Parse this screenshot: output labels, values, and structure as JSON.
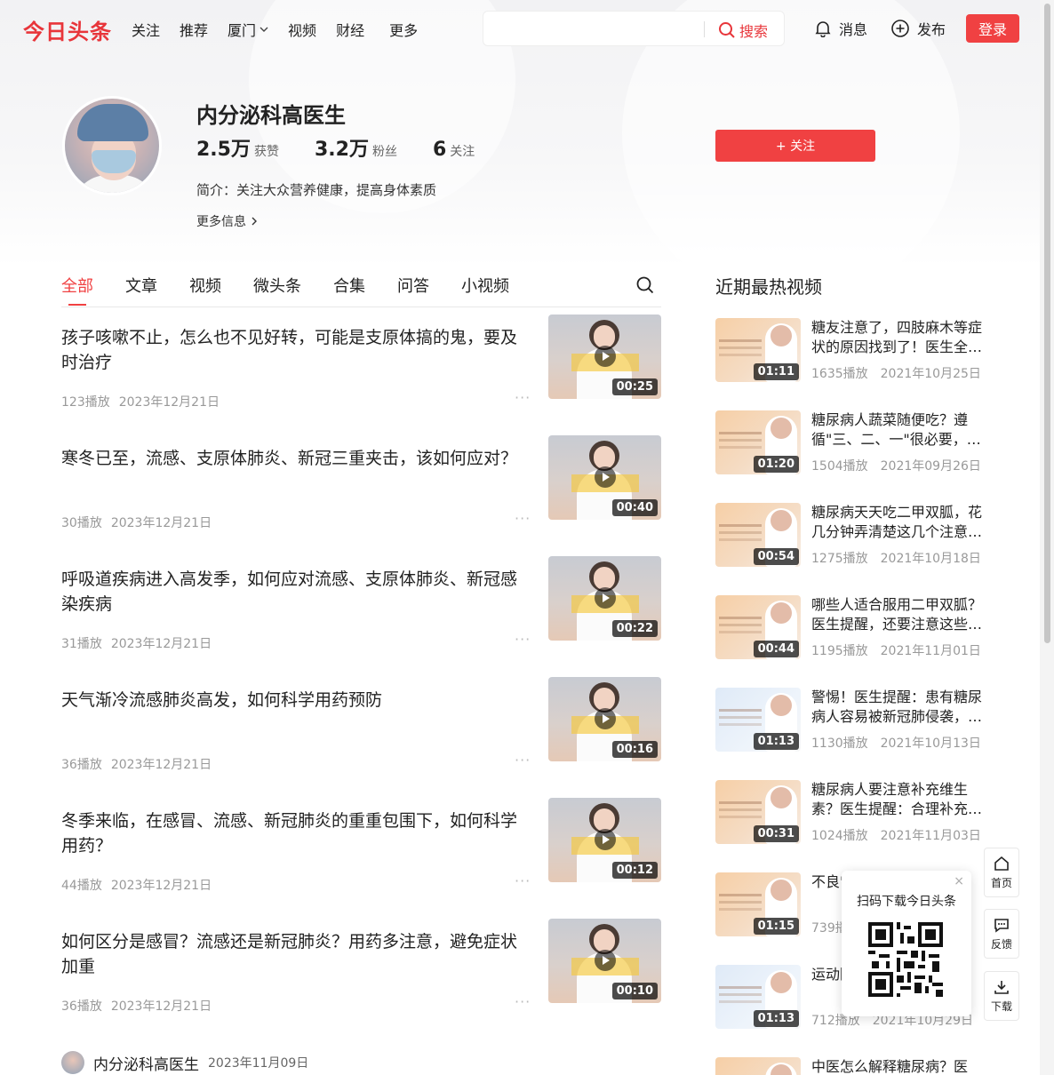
{
  "header": {
    "logo": "今日头条",
    "nav": [
      "关注",
      "推荐",
      "厦门",
      "视频",
      "财经",
      "更多"
    ],
    "search_button": "搜索",
    "search_placeholder": "",
    "messages": "消息",
    "publish": "发布",
    "login": "登录"
  },
  "profile": {
    "name": "内分泌科高医生",
    "likes_num": "2.5万",
    "likes_label": "获赞",
    "fans_num": "3.2万",
    "fans_label": "粉丝",
    "following_num": "6",
    "following_label": "关注",
    "follow_button": "+ 关注",
    "intro": "简介：关注大众营养健康，提高身体素质",
    "more_info": "更多信息"
  },
  "tabs": [
    "全部",
    "文章",
    "视频",
    "微头条",
    "合集",
    "问答",
    "小视频"
  ],
  "feed": [
    {
      "title": "孩子咳嗽不止，怎么也不见好转，可能是支原体搞的鬼，要及时治疗",
      "plays": "123播放",
      "date": "2023年12月21日",
      "duration": "00:25"
    },
    {
      "title": "寒冬已至，流感、支原体肺炎、新冠三重夹击，该如何应对？",
      "plays": "30播放",
      "date": "2023年12月21日",
      "duration": "00:40"
    },
    {
      "title": "呼吸道疾病进入高发季，如何应对流感、支原体肺炎、新冠感染疾病",
      "plays": "31播放",
      "date": "2023年12月21日",
      "duration": "00:22"
    },
    {
      "title": "天气渐冷流感肺炎高发，如何科学用药预防",
      "plays": "36播放",
      "date": "2023年12月21日",
      "duration": "00:16"
    },
    {
      "title": "冬季来临，在感冒、流感、新冠肺炎的重重包围下，如何科学用药？",
      "plays": "44播放",
      "date": "2023年12月21日",
      "duration": "00:12"
    },
    {
      "title": "如何区分是感冒？流感还是新冠肺炎？用药多注意，避免症状加重",
      "plays": "36播放",
      "date": "2023年12月21日",
      "duration": "00:10"
    }
  ],
  "author_row": {
    "name": "内分泌科高医生",
    "date": "2023年11月09日"
  },
  "sidebar": {
    "title": "近期最热视频",
    "videos": [
      {
        "title": "糖友注意了，四肢麻木等症状的原因找到了！医生全…",
        "plays": "1635播放",
        "date": "2021年10月25日",
        "duration": "01:11",
        "style": "orange"
      },
      {
        "title": "糖尿病人蔬菜随便吃？遵循\"三、二、一\"很必要，…",
        "plays": "1504播放",
        "date": "2021年09月26日",
        "duration": "01:20",
        "style": "orange"
      },
      {
        "title": "糖尿病天天吃二甲双胍，花几分钟弄清楚这几个注意…",
        "plays": "1275播放",
        "date": "2021年10月18日",
        "duration": "00:54",
        "style": "orange"
      },
      {
        "title": "哪些人适合服用二甲双胍？医生提醒，还要注意这些…",
        "plays": "1195播放",
        "date": "2021年11月01日",
        "duration": "00:44",
        "style": "orange"
      },
      {
        "title": "警惕！医生提醒：患有糖尿病人容易被新冠肺侵袭，…",
        "plays": "1130播放",
        "date": "2021年10月13日",
        "duration": "01:13",
        "style": "blue"
      },
      {
        "title": "糖尿病人要注意补充维生素？医生提醒：合理补充…",
        "plays": "1024播放",
        "date": "2021年11月03日",
        "duration": "00:31",
        "style": "orange"
      },
      {
        "title": "不良\"根\"，",
        "plays": "739播",
        "date": "",
        "duration": "01:15",
        "style": "orange"
      },
      {
        "title": "运动防低",
        "plays": "712播放",
        "date": "2021年10月29日",
        "duration": "01:13",
        "style": "blue"
      },
      {
        "title": "中医怎么解释糖尿病？医",
        "plays": "",
        "date": "",
        "duration": "",
        "style": "orange"
      }
    ]
  },
  "qr_popup": {
    "title": "扫码下载今日头条",
    "close": "×"
  },
  "float_buttons": {
    "home": "首页",
    "feedback": "反馈",
    "download": "下载"
  }
}
